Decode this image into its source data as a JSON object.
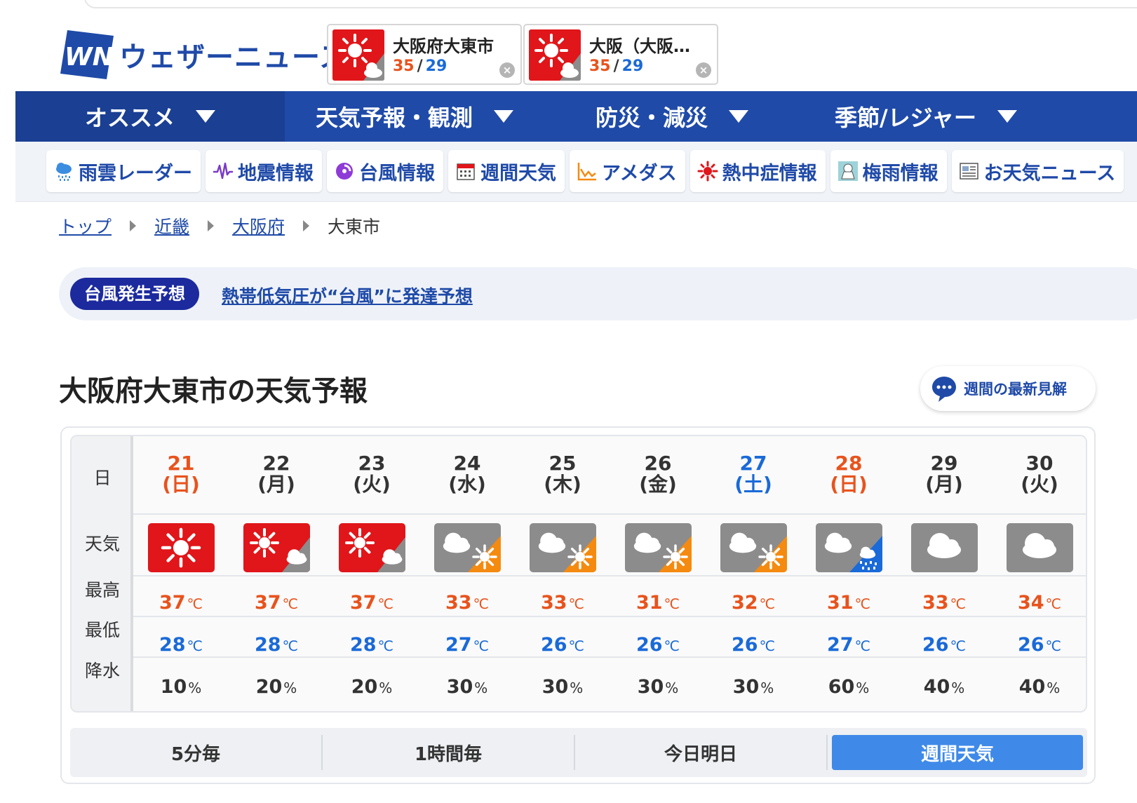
{
  "header": {
    "logo_text": "ウェザーニュース",
    "brand_color": "#1f4aa8",
    "favorites": [
      {
        "name": "大阪府大東市",
        "high": "35",
        "low": "29",
        "icon": "sunny-then-cloudy-icon"
      },
      {
        "name": "大阪（大阪…",
        "high": "35",
        "low": "29",
        "icon": "sunny-then-cloudy-icon"
      }
    ],
    "close_glyph": "×"
  },
  "main_nav": {
    "items": [
      {
        "label": "オススメ",
        "active": true
      },
      {
        "label": "天気予報・観測",
        "active": false
      },
      {
        "label": "防災・減災",
        "active": false
      },
      {
        "label": "季節/レジャー",
        "active": false
      }
    ]
  },
  "sub_nav": {
    "items": [
      {
        "label": "雨雲レーダー",
        "icon": "rain-cloud-icon"
      },
      {
        "label": "地震情報",
        "icon": "seismograph-icon"
      },
      {
        "label": "台風情報",
        "icon": "typhoon-icon"
      },
      {
        "label": "週間天気",
        "icon": "calendar-icon"
      },
      {
        "label": "アメダス",
        "icon": "line-chart-icon"
      },
      {
        "label": "熱中症情報",
        "icon": "heat-sun-icon"
      },
      {
        "label": "梅雨情報",
        "icon": "teru-teru-bozu-icon"
      },
      {
        "label": "お天気ニュース",
        "icon": "newspaper-icon"
      }
    ]
  },
  "breadcrumb": {
    "items": [
      "トップ",
      "近畿",
      "大阪府"
    ],
    "current": "大東市"
  },
  "alert": {
    "badge": "台風発生予想",
    "link": "熱帯低気圧が“台風”に発達予想"
  },
  "forecast": {
    "title": "大阪府大東市の天気予報",
    "latest_button": "週間の最新見解",
    "row_labels": {
      "date": "日",
      "weather": "天気",
      "high": "最高",
      "low": "最低",
      "pop": "降水"
    },
    "units": {
      "temp": "℃",
      "pop": "%"
    },
    "days": [
      {
        "day": "21",
        "dow": "(日)",
        "kind": "sun",
        "icon": "sunny",
        "high": "37",
        "low": "28",
        "pop": "10"
      },
      {
        "day": "22",
        "dow": "(月)",
        "kind": "weekday",
        "icon": "sunny-then-cloudy",
        "high": "37",
        "low": "28",
        "pop": "20"
      },
      {
        "day": "23",
        "dow": "(火)",
        "kind": "weekday",
        "icon": "sunny-then-cloudy",
        "high": "37",
        "low": "28",
        "pop": "20"
      },
      {
        "day": "24",
        "dow": "(水)",
        "kind": "weekday",
        "icon": "cloudy-then-sunny",
        "high": "33",
        "low": "27",
        "pop": "30"
      },
      {
        "day": "25",
        "dow": "(木)",
        "kind": "weekday",
        "icon": "cloudy-then-sunny",
        "high": "33",
        "low": "26",
        "pop": "30"
      },
      {
        "day": "26",
        "dow": "(金)",
        "kind": "weekday",
        "icon": "cloudy-then-sunny",
        "high": "31",
        "low": "26",
        "pop": "30"
      },
      {
        "day": "27",
        "dow": "(土)",
        "kind": "sat",
        "icon": "cloudy-then-sunny",
        "high": "32",
        "low": "26",
        "pop": "30"
      },
      {
        "day": "28",
        "dow": "(日)",
        "kind": "sun",
        "icon": "cloudy-then-rain",
        "high": "31",
        "low": "27",
        "pop": "60"
      },
      {
        "day": "29",
        "dow": "(月)",
        "kind": "weekday",
        "icon": "cloudy",
        "high": "33",
        "low": "26",
        "pop": "40"
      },
      {
        "day": "30",
        "dow": "(火)",
        "kind": "weekday",
        "icon": "cloudy",
        "high": "34",
        "low": "26",
        "pop": "40"
      }
    ],
    "colors": {
      "sunny_bg": "#e0161a",
      "cloudy_bg": "#8c8c8c",
      "sun_orange": "#f58a10",
      "rain_blue": "#1a6ad8",
      "high_temp": "#e8531d",
      "low_temp": "#1a6ad8"
    }
  },
  "period_tabs": {
    "items": [
      {
        "label": "5分毎",
        "active": false
      },
      {
        "label": "1時間毎",
        "active": false
      },
      {
        "label": "今日明日",
        "active": false
      },
      {
        "label": "週間天気",
        "active": true
      }
    ]
  }
}
